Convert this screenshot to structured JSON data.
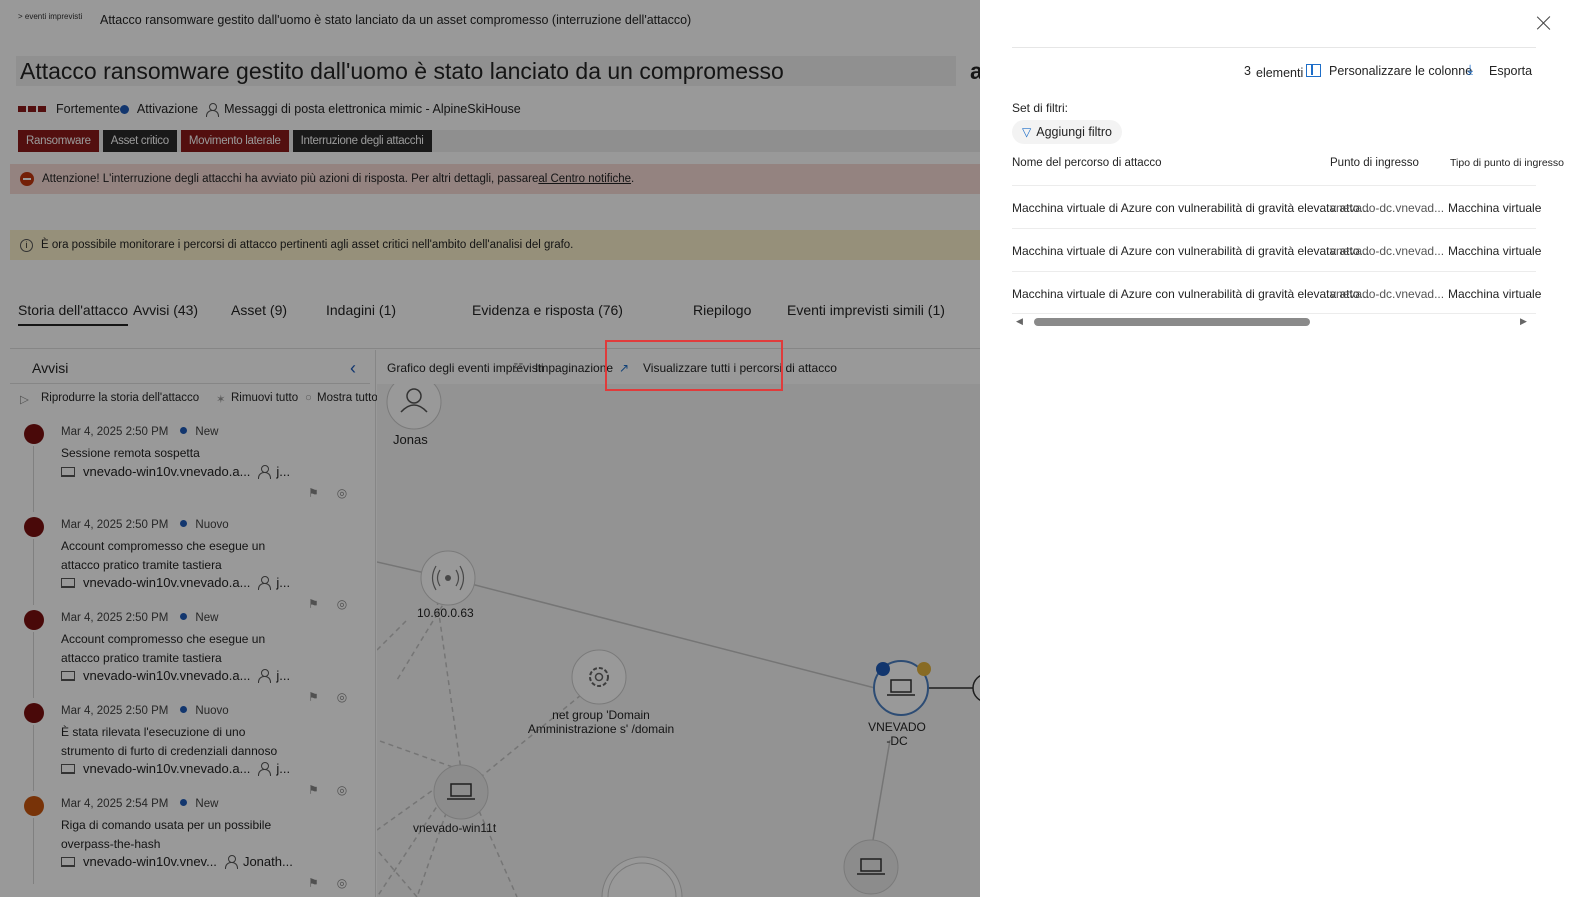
{
  "breadcrumb": "&gt; eventi imprevisti",
  "header": {
    "crumb_title": "Attacco ransomware gestito dall'uomo è stato lanciato da un asset compromesso (interruzione dell'attacco)",
    "title": "Attacco ransomware gestito dall'uomo è stato lanciato da un compromesso",
    "title_overflow": "a",
    "severity": "Fortemente",
    "status": "Attivazione",
    "assigned": "Messaggi di posta elettronica mimic - AlpineSkiHouse",
    "tags": [
      "Ransomware",
      "Asset critico",
      "Movimento laterale",
      "Interruzione degli attacchi"
    ]
  },
  "alert_bar": {
    "text": "Attenzione! L'interruzione degli attacchi ha avviato più azioni di risposta. Per altri dettagli, passare ",
    "link": "al Centro notifiche",
    "suffix": "."
  },
  "info_bar": {
    "text": "È ora possibile monitorare i percorsi di attacco pertinenti agli asset critici nell'ambito dell'analisi del grafo."
  },
  "tabs": [
    "Storia dell'attacco",
    "Avvisi (43)",
    "Asset (9)",
    "Indagini (1)",
    "Evidenza e risposta (76)",
    "Riepilogo",
    "Eventi imprevisti simili (1)"
  ],
  "alerts_panel": {
    "title": "Avvisi",
    "play": "Riprodurre la storia dell'attacco",
    "remove_all": "Rimuovi tutto",
    "show_all": "Mostra tutto",
    "items": [
      {
        "date": "Mar 4, 2025 2:50 PM",
        "status": "New",
        "name": "Sessione remota sospetta",
        "device": "vnevado-win10v.vnevado.a...",
        "user": "j...",
        "color": "#7a1010"
      },
      {
        "date": "Mar 4, 2025 2:50 PM",
        "status": "Nuovo",
        "name": "Account compromesso che esegue un attacco pratico tramite tastiera",
        "device": "vnevado-win10v.vnevado.a...",
        "user": "j...",
        "color": "#7a1010"
      },
      {
        "date": "Mar 4, 2025 2:50 PM",
        "status": "New",
        "name": "Account compromesso che esegue un attacco pratico tramite tastiera",
        "device": "vnevado-win10v.vnevado.a...",
        "user": "j...",
        "color": "#7a1010"
      },
      {
        "date": "Mar 4, 2025 2:50 PM",
        "status": "Nuovo",
        "name": "È stata rilevata l'esecuzione di uno strumento di furto di credenziali dannoso",
        "device": "vnevado-win10v.vnevado.a...",
        "user": "j...",
        "color": "#7a1010"
      },
      {
        "date": "Mar 4, 2025 2:54 PM",
        "status": "New",
        "name": "Riga di comando usata per un possibile overpass-the-hash",
        "device": "vnevado-win10v.vnev...",
        "user": "Jonath...",
        "color": "#c8560e"
      }
    ]
  },
  "graph": {
    "toolbar": {
      "incident_graph": "Grafico degli eventi imprevisti",
      "layout": "Impaginazione",
      "view_paths": "Visualizzare tutti i percorsi di attacco"
    },
    "nodes": {
      "user": "Jonas",
      "ip": "10.60.0.63",
      "process": "net group 'Domain Amministrazione s' /domain",
      "dc": "VNEVADO -DC",
      "device": "vnevado-win11t"
    }
  },
  "flyout": {
    "count": "3",
    "count_label": "elementi",
    "customize": "Personalizzare le colonne",
    "export": "Esporta",
    "filter_set": "Set di filtri:",
    "add_filter": "Aggiungi filtro",
    "columns": [
      "Nome del percorso di attacco",
      "Punto di ingresso",
      "Tipo di punto di ingresso"
    ],
    "rows": [
      {
        "name": "Macchina virtuale di Azure con vulnerabilità di gravità elevata atto...",
        "entry": "vnevado-dc.vnevad...",
        "type": "Macchina virtuale"
      },
      {
        "name": "Macchina virtuale di Azure con vulnerabilità di gravità elevata atto...",
        "entry": "vnevado-dc.vnevad...",
        "type": "Macchina virtuale"
      },
      {
        "name": "Macchina virtuale di Azure con vulnerabilità di gravità elevata atto...",
        "entry": "vnevado-dc.vnevad...",
        "type": "Macchina virtuale"
      }
    ]
  },
  "icons": [
    "person-icon",
    "laptop-icon",
    "pin-icon",
    "hide-icon",
    "chevron-left-icon",
    "play-icon",
    "filter-icon",
    "columns-icon",
    "download-icon",
    "close-icon",
    "gear-icon",
    "broadcast-icon",
    "attack-path-icon",
    "crown-icon"
  ],
  "colors": {
    "severity_high": "#8b1a1a",
    "accent": "#1e6ec8",
    "highlight_box": "#e03b3b"
  }
}
